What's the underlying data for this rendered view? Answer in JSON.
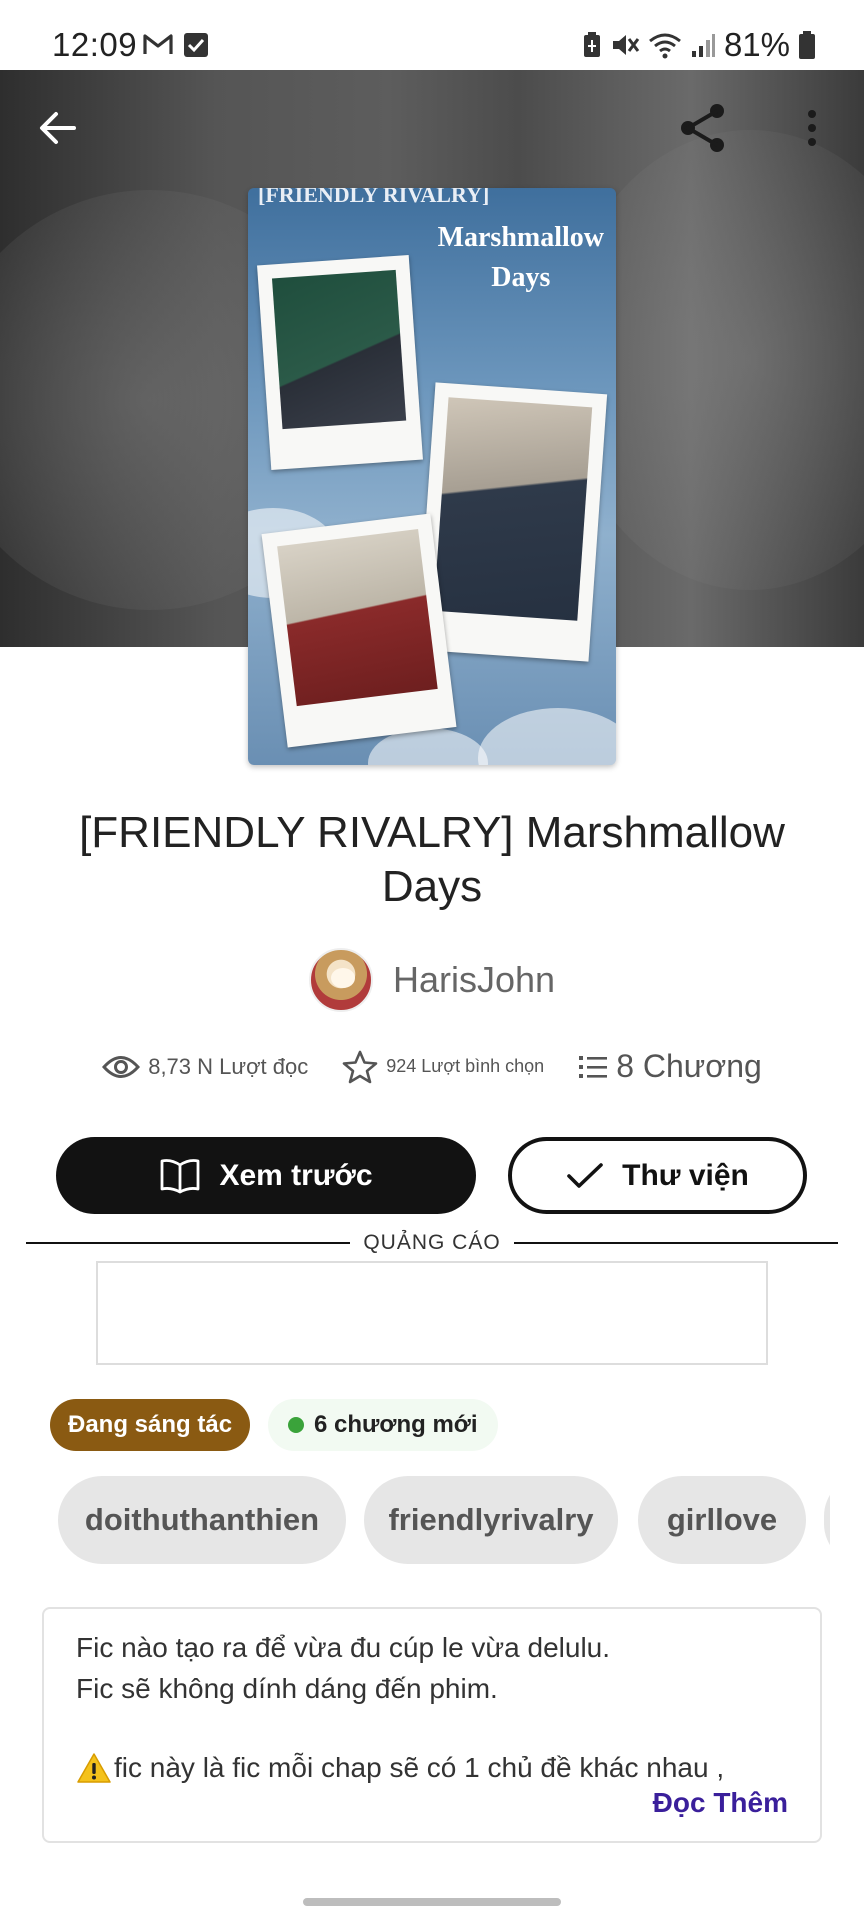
{
  "status_bar": {
    "time": "12:09",
    "battery": "81%",
    "left_icons": [
      "gmail-icon",
      "checkbox-icon"
    ],
    "right_icons": [
      "battery-saver-icon",
      "mute-icon",
      "wifi-icon",
      "signal-icon",
      "battery-icon"
    ]
  },
  "header": {
    "back_icon": "arrow-left-icon",
    "share_icon": "share-icon",
    "menu_icon": "more-vertical-icon"
  },
  "cover": {
    "top_text": "[FRIENDLY RIVALRY]",
    "title_line1": "Marshmallow",
    "title_line2": "Days"
  },
  "story": {
    "title": "[FRIENDLY RIVALRY] Marshmallow Days",
    "author": "HarisJohn"
  },
  "stats": {
    "reads": "8,73 N Lượt đọc",
    "votes": "924 Lượt bình chọn",
    "chapters": "8 Chương"
  },
  "actions": {
    "preview_label": "Xem trước",
    "library_label": "Thư viện"
  },
  "ad": {
    "label": "QUẢNG CÁO"
  },
  "status_tags": {
    "ongoing": "Đang sáng tác",
    "new_chapters": "6 chương mới"
  },
  "tags": [
    "doithuthanthien",
    "friendlyrivalry",
    "girllove"
  ],
  "description": {
    "line1": "Fic nào tạo ra để vừa đu cúp le vừa delulu.",
    "line2": "Fic sẽ không dính dáng đến phim.",
    "line3": "fic này là fic mỗi chap sẽ có 1 chủ đề khác nhau ,",
    "read_more": "Đọc Thêm"
  },
  "colors": {
    "primary_button": "#121212",
    "status_tag": "#8a5a12",
    "new_dot": "#3aa33a",
    "read_more": "#3a1f9b"
  }
}
